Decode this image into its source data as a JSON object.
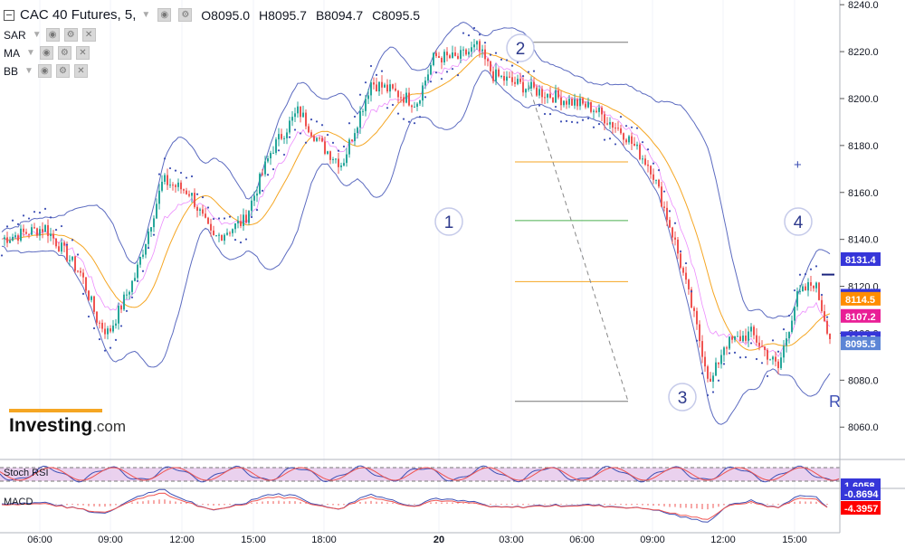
{
  "header": {
    "symbol": "CAC 40 Futures, 5,",
    "ohlc": {
      "o": "O8095.0",
      "h": "H8095.7",
      "b": "B8094.7",
      "c": "C8095.5"
    }
  },
  "indicators": [
    {
      "name": "SAR"
    },
    {
      "name": "MA"
    },
    {
      "name": "BB"
    }
  ],
  "logo": {
    "text": "Investing",
    "suffix": ".com"
  },
  "subpanes": {
    "stoch_label": "Stoch RSI",
    "macd_label": "MACD",
    "stoch_value": "1.6058",
    "macd_values": [
      "-0.8694",
      "-4.3957"
    ]
  },
  "colors": {
    "up": "#26a69a",
    "down": "#ef5350",
    "bb": "#5c6bc0",
    "ma": "#f5a623",
    "sar": "#3f51b5",
    "price_label": "#3636d9",
    "ma_label": "#ff8c00",
    "pink_label": "#e91e96",
    "last_label": "#5c85d6",
    "macd_label": "#ff0000"
  },
  "chart_data": {
    "type": "candlestick",
    "y_range": [
      8052,
      8242
    ],
    "y_ticks": [
      "8240.0",
      "8220.0",
      "8200.0",
      "8180.0",
      "8160.0",
      "8140.0",
      "8120.0",
      "8100.0",
      "8080.0",
      "8060.0"
    ],
    "x_ticks": [
      "06:00",
      "09:00",
      "12:00",
      "15:00",
      "18:00",
      "20",
      "03:00",
      "06:00",
      "09:00",
      "12:00",
      "15:00"
    ],
    "close_path": [
      {
        "t": 0,
        "p": 8140
      },
      {
        "t": 50,
        "p": 8145
      },
      {
        "t": 90,
        "p": 8125
      },
      {
        "t": 108,
        "p": 8105
      },
      {
        "t": 120,
        "p": 8100
      },
      {
        "t": 150,
        "p": 8125
      },
      {
        "t": 180,
        "p": 8165
      },
      {
        "t": 210,
        "p": 8160
      },
      {
        "t": 235,
        "p": 8140
      },
      {
        "t": 270,
        "p": 8148
      },
      {
        "t": 300,
        "p": 8178
      },
      {
        "t": 330,
        "p": 8195
      },
      {
        "t": 355,
        "p": 8180
      },
      {
        "t": 378,
        "p": 8172
      },
      {
        "t": 410,
        "p": 8207
      },
      {
        "t": 440,
        "p": 8202
      },
      {
        "t": 460,
        "p": 8198
      },
      {
        "t": 480,
        "p": 8218
      },
      {
        "t": 505,
        "p": 8217
      },
      {
        "t": 527,
        "p": 8222
      },
      {
        "t": 545,
        "p": 8210
      },
      {
        "t": 580,
        "p": 8205
      },
      {
        "t": 620,
        "p": 8200
      },
      {
        "t": 655,
        "p": 8196
      },
      {
        "t": 690,
        "p": 8185
      },
      {
        "t": 720,
        "p": 8170
      },
      {
        "t": 745,
        "p": 8140
      },
      {
        "t": 765,
        "p": 8110
      },
      {
        "t": 785,
        "p": 8078
      },
      {
        "t": 800,
        "p": 8095
      },
      {
        "t": 830,
        "p": 8100
      },
      {
        "t": 860,
        "p": 8085
      },
      {
        "t": 880,
        "p": 8115
      },
      {
        "t": 900,
        "p": 8122
      },
      {
        "t": 918,
        "p": 8097
      }
    ],
    "price_labels": [
      {
        "text": "8131.4",
        "price": 8131.4,
        "color": "#3636d9"
      },
      {
        "text": "8115.8",
        "price": 8115.8,
        "color": "#3636d9"
      },
      {
        "text": "8114.5",
        "price": 8114.5,
        "color": "#ff8c00"
      },
      {
        "text": "8107.2",
        "price": 8107.2,
        "color": "#e91e96"
      },
      {
        "text": "8097.7",
        "price": 8097.7,
        "color": "#3636d9"
      },
      {
        "text": "8095.5",
        "price": 8095.5,
        "color": "#5c85d6"
      }
    ],
    "annotations": [
      {
        "label": "1",
        "kind": "circle"
      },
      {
        "label": "2",
        "kind": "circle"
      },
      {
        "label": "3",
        "kind": "circle"
      },
      {
        "label": "4",
        "kind": "circle"
      },
      {
        "label": "R",
        "kind": "text"
      },
      {
        "label": "+",
        "kind": "text"
      }
    ],
    "fib_levels": [
      8224,
      8173,
      8148,
      8122,
      8071
    ]
  }
}
